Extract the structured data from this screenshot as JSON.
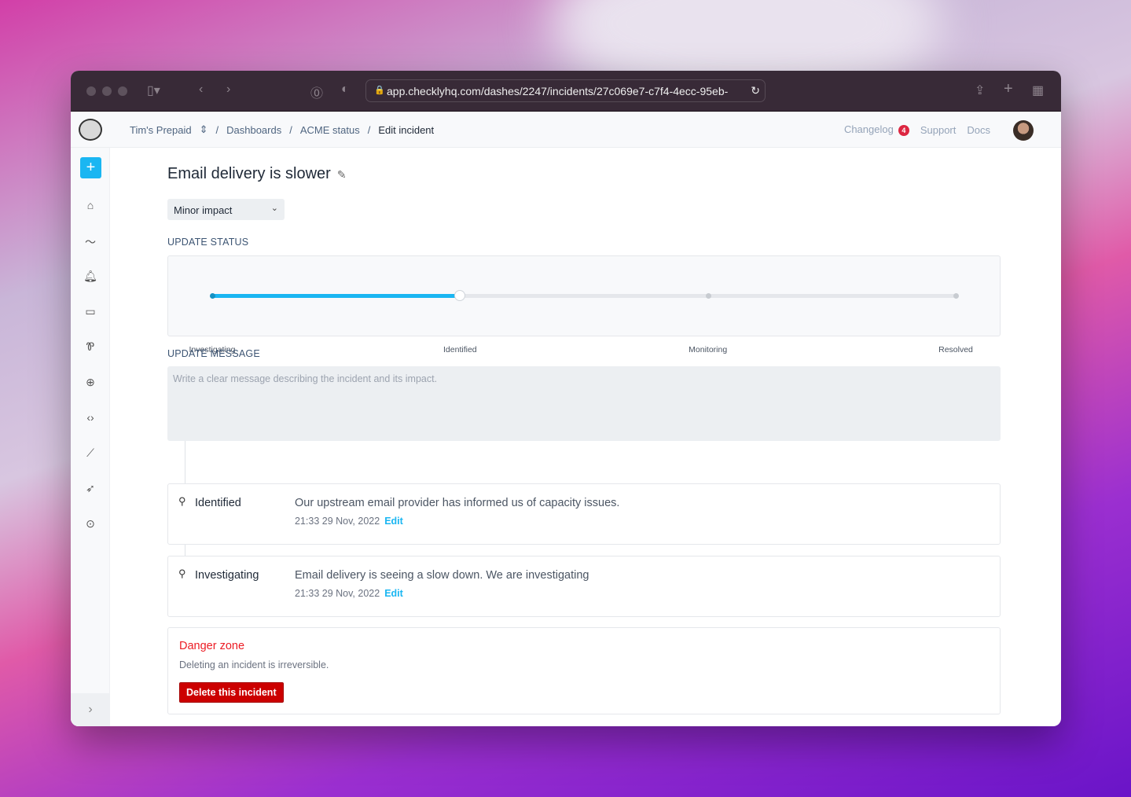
{
  "browser": {
    "url": "app.checklyhq.com/dashes/2247/incidents/27c069e7-c7f4-4ecc-95eb-"
  },
  "header": {
    "breadcrumbs": [
      "Tim's Prepaid",
      "Dashboards",
      "ACME status",
      "Edit incident"
    ],
    "links": {
      "changelog": "Changelog",
      "changelog_count": "4",
      "support": "Support",
      "docs": "Docs"
    }
  },
  "sidebar": {
    "items": [
      "home-icon",
      "activity-icon",
      "bell-icon",
      "monitor-icon",
      "wrench-icon",
      "globe-icon",
      "code-icon",
      "chart-icon",
      "rocket-icon",
      "location-icon"
    ]
  },
  "incident": {
    "title": "Email delivery is slower",
    "impact": "Minor impact",
    "update_status_label": "UPDATE STATUS",
    "statuses": [
      "Investigating",
      "Identified",
      "Monitoring",
      "Resolved"
    ],
    "current_status": "Identified",
    "progress_fraction": 0.3333,
    "update_message_label": "UPDATE MESSAGE",
    "message_placeholder": "Write a clear message describing the incident and its impact."
  },
  "updates": [
    {
      "status": "Identified",
      "message": "Our upstream email provider has informed us of capacity issues.",
      "time": "21:33 29 Nov, 2022",
      "edit": "Edit"
    },
    {
      "status": "Investigating",
      "message": "Email delivery is seeing a slow down. We are investigating",
      "time": "21:33 29 Nov, 2022",
      "edit": "Edit"
    }
  ],
  "danger": {
    "title": "Danger zone",
    "description": "Deleting an incident is irreversible.",
    "button": "Delete this incident"
  },
  "colors": {
    "accent": "#1ab6f2",
    "danger": "#cc0000",
    "badge": "#dc2641"
  }
}
